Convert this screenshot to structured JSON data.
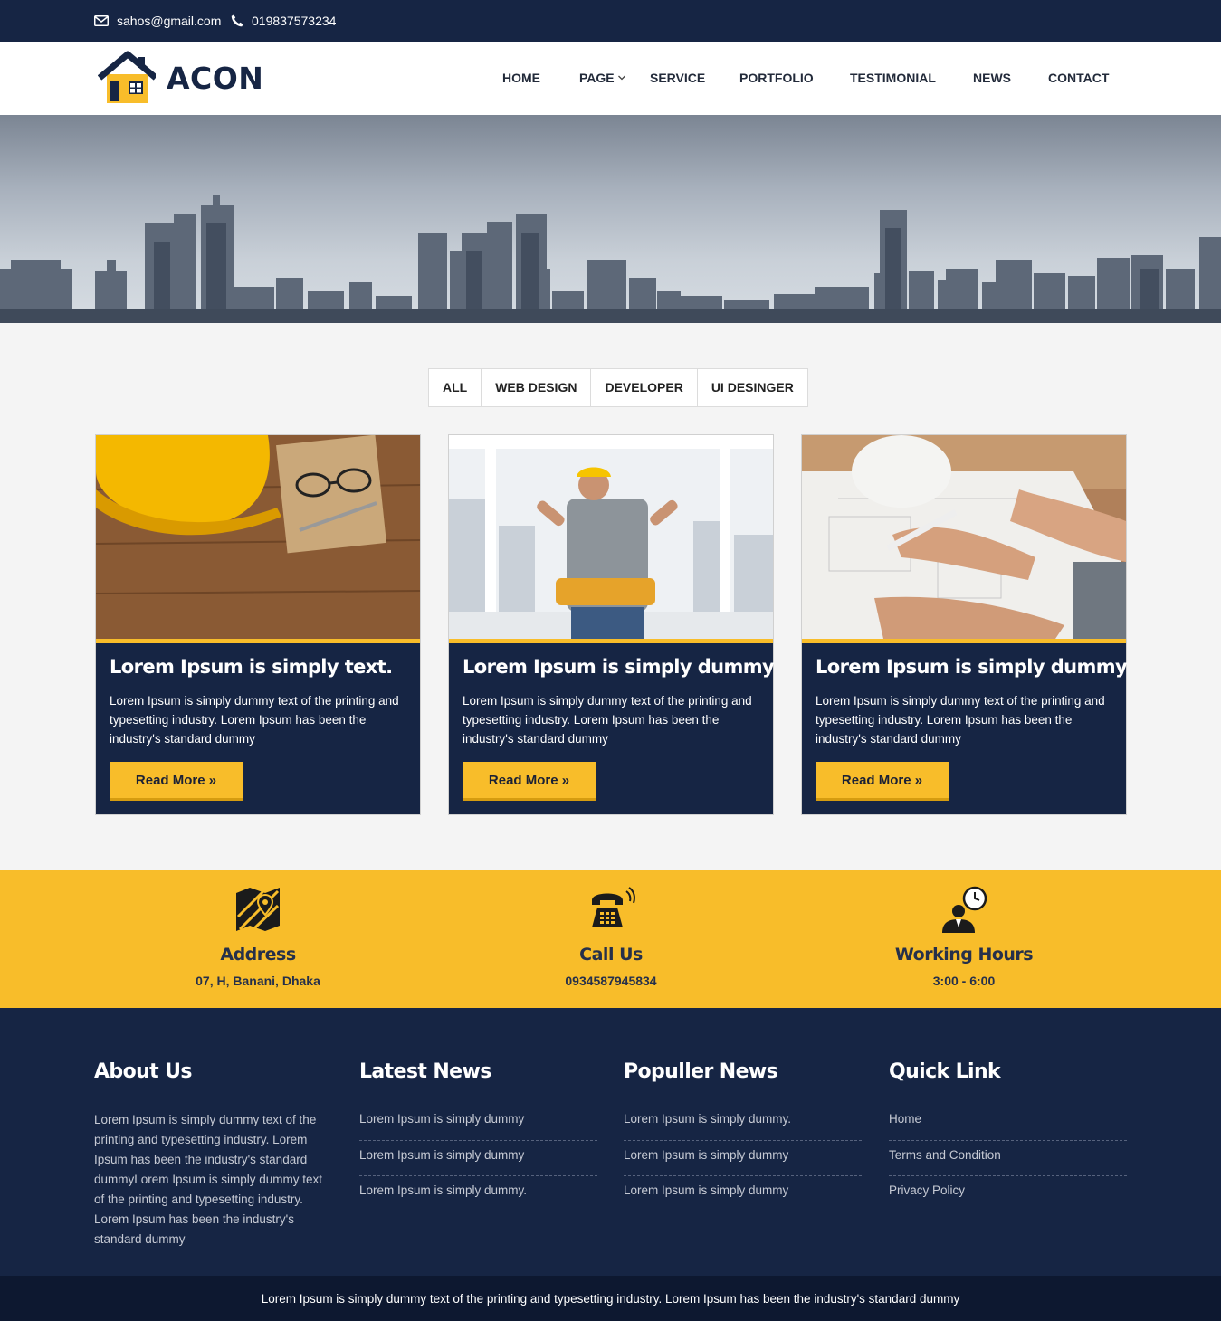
{
  "topbar": {
    "email": "sahos@gmail.com",
    "phone": "019837573234"
  },
  "header": {
    "logo_text": "ACON",
    "nav": [
      {
        "label": "HOME"
      },
      {
        "label": "PAGE"
      },
      {
        "label": "SERVICE"
      },
      {
        "label": "PORTFOLIO"
      },
      {
        "label": "TESTIMONIAL"
      },
      {
        "label": "NEWS"
      },
      {
        "label": "CONTACT"
      }
    ]
  },
  "filters": [
    "ALL",
    "WEB DESIGN",
    "DEVELOPER",
    "UI DESINGER"
  ],
  "cards": [
    {
      "title": "Lorem Ipsum is simply text.",
      "description": "Lorem Ipsum is simply dummy text of the printing and typesetting industry. Lorem Ipsum has been the industry's standard dummy",
      "button": "Read More »"
    },
    {
      "title": "Lorem Ipsum is simply dummy",
      "description": "Lorem Ipsum is simply dummy text of the printing and typesetting industry. Lorem Ipsum has been the industry's standard dummy",
      "button": "Read More »"
    },
    {
      "title": "Lorem Ipsum is simply dummy",
      "description": "Lorem Ipsum is simply dummy text of the printing and typesetting industry. Lorem Ipsum has been the industry's standard dummy",
      "button": "Read More »"
    }
  ],
  "contact_info": [
    {
      "icon": "map-icon",
      "label": "Address",
      "value": "07, H, Banani, Dhaka"
    },
    {
      "icon": "telephone-icon",
      "label": "Call Us",
      "value": "0934587945834"
    },
    {
      "icon": "clock-person-icon",
      "label": "Working Hours",
      "value": "3:00 - 6:00"
    }
  ],
  "footer": {
    "about": {
      "title": "About Us",
      "text": "Lorem Ipsum is simply dummy text of the printing and typesetting industry. Lorem Ipsum has been the industry's standard dummyLorem Ipsum is simply dummy text of the printing and typesetting industry. Lorem Ipsum has been the industry's standard dummy"
    },
    "latest_news": {
      "title": "Latest News",
      "items": [
        "Lorem Ipsum is simply dummy",
        "Lorem Ipsum is simply dummy",
        "Lorem Ipsum is simply dummy."
      ]
    },
    "popular_news": {
      "title": "Populler News",
      "items": [
        "Lorem Ipsum is simply dummy.",
        "Lorem Ipsum is simply dummy",
        "Lorem Ipsum is simply dummy"
      ]
    },
    "quick_link": {
      "title": "Quick Link",
      "items": [
        "Home",
        "Terms and Condition",
        "Privacy Policy"
      ]
    }
  },
  "copyright": "Lorem Ipsum is simply dummy text of the printing and typesetting industry. Lorem Ipsum has been the industry's standard dummy",
  "colors": {
    "navy": "#162544",
    "accent_yellow": "#f8bd2a",
    "copyright_bg": "#0d1830"
  }
}
